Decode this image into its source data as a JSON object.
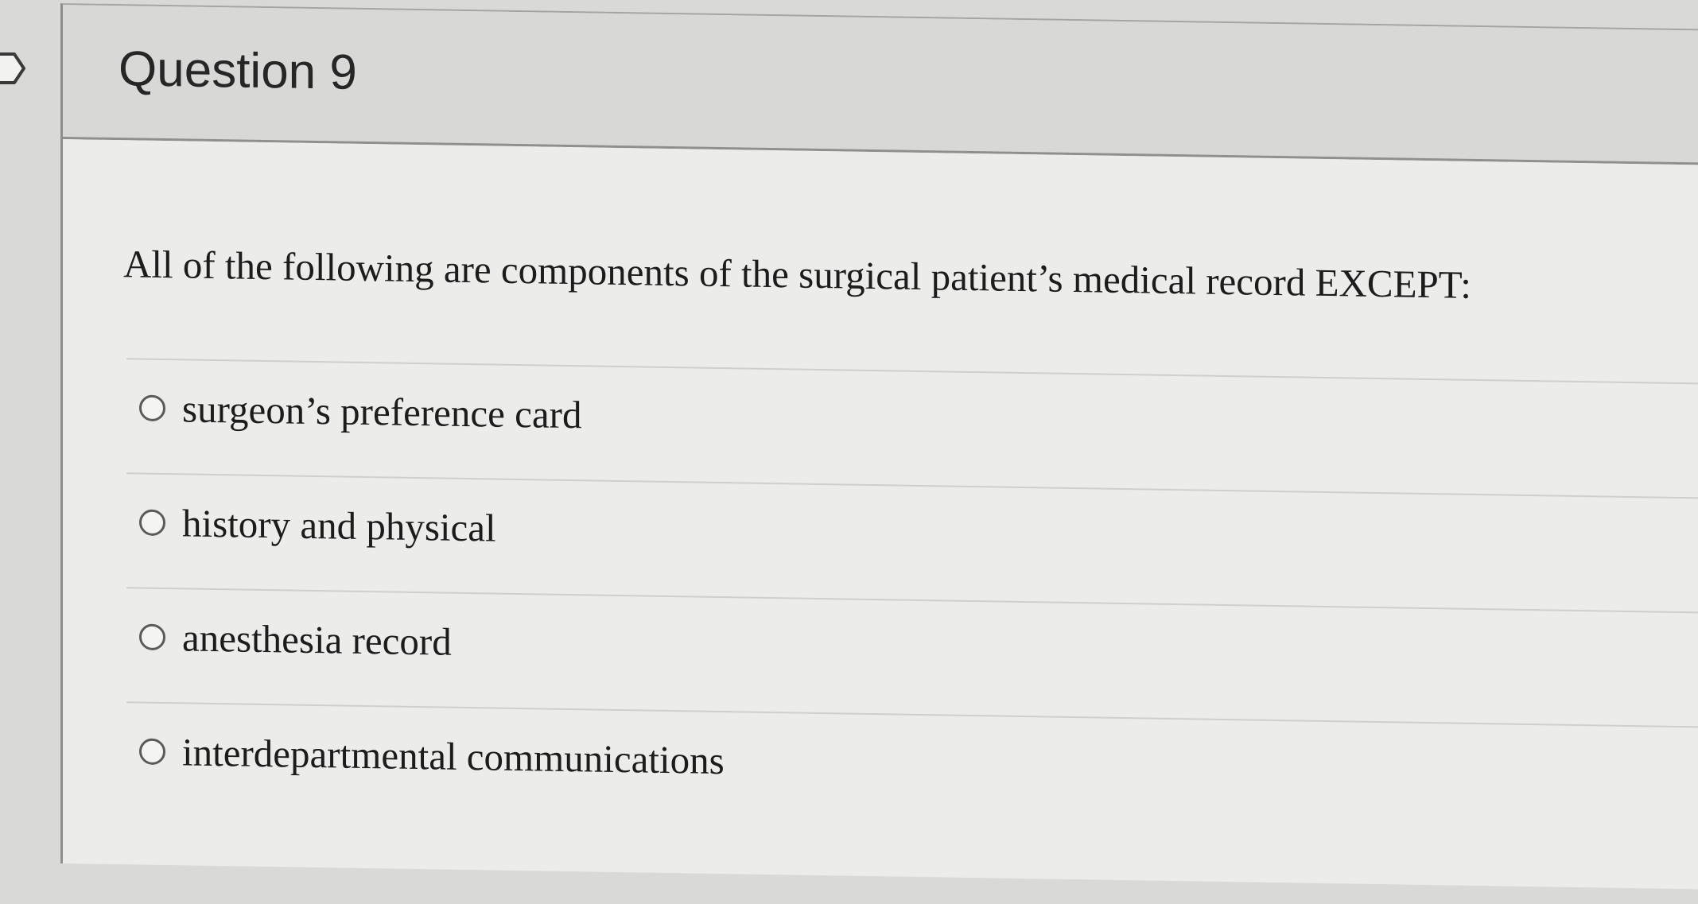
{
  "question": {
    "title": "Question 9",
    "prompt": "All of the following are components of the surgical patient’s medical record EXCEPT:",
    "answers": [
      {
        "label": "surgeon’s preference card",
        "selected": false
      },
      {
        "label": "history and physical",
        "selected": false
      },
      {
        "label": "anesthesia record",
        "selected": false
      },
      {
        "label": "interdepartmental communications",
        "selected": false
      }
    ]
  },
  "icons": {
    "flag": "flag-icon"
  }
}
